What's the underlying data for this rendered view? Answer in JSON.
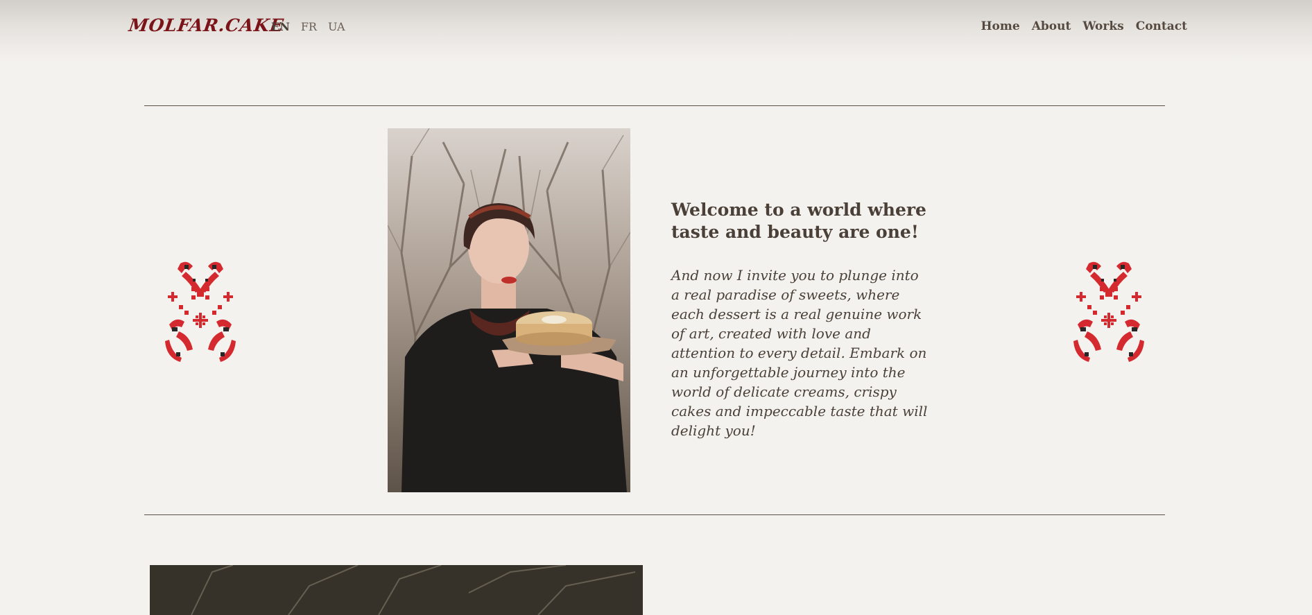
{
  "header": {
    "logo": "MOLFAR.CAKE",
    "languages": [
      {
        "label": "EN",
        "active": true
      },
      {
        "label": "FR",
        "active": false
      },
      {
        "label": "UA",
        "active": false
      }
    ],
    "nav": [
      "Home",
      "About",
      "Works",
      "Contact"
    ]
  },
  "hero": {
    "title": "Welcome to a world where taste and beauty are one!",
    "text": "And now I invite you to plunge into a real paradise of sweets, where each dessert is a real genuine work of art, created with love and attention to every detail. Embark on an unforgettable journey into the world of delicate creams, crispy cakes and impeccable taste that will delight you!"
  },
  "colors": {
    "background": "#f4f2ef",
    "brand": "#7b1418",
    "text": "#4a4038",
    "ornament_red": "#d42a2f",
    "ornament_dark": "#2b2626"
  },
  "icons": {
    "ornament": "ukrainian-embroidery-ornament"
  }
}
